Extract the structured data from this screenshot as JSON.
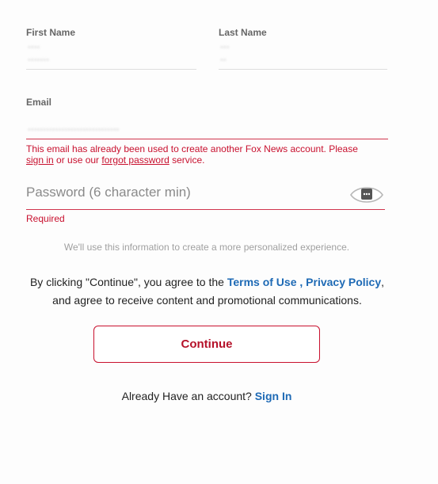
{
  "form": {
    "first_name": {
      "label": "First Name",
      "line1": "••••",
      "line2": "•••••••"
    },
    "last_name": {
      "label": "Last Name",
      "line1": "•••",
      "line2": "••"
    },
    "email": {
      "label": "Email",
      "value": "••••••••••••••••••••••••••••••",
      "error_text_1": "This email has already been used to create another Fox News account. Please",
      "error_link_signin": "sign in",
      "error_text_2": " or use our ",
      "error_link_forgot": "forgot password",
      "error_text_3": " service."
    },
    "password": {
      "placeholder": "Password (6 character min)",
      "error": "Required",
      "icon": "eye-icon"
    }
  },
  "info_text": "We'll use this information to create a more personalized experience.",
  "terms": {
    "prefix": "By clicking \"Continue\", you agree to the ",
    "terms_link": "Terms of Use",
    "separator": " , ",
    "privacy_link": "Privacy Policy",
    "suffix": ",",
    "line2": "and agree to receive content and promotional communications."
  },
  "continue_label": "Continue",
  "signin_row": {
    "prompt": "Already Have an account?",
    "link": "Sign In"
  },
  "colors": {
    "accent_red": "#c8102e",
    "link_blue": "#1e6ab5"
  }
}
